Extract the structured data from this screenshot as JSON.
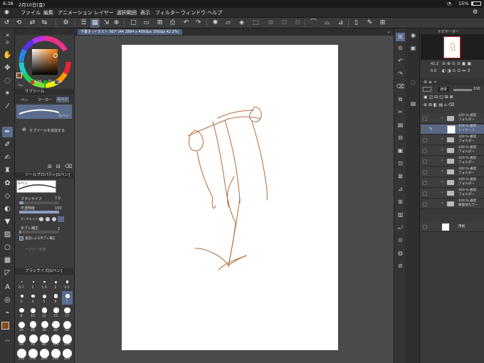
{
  "status": {
    "time": "6:38",
    "date": "2月10日(金)",
    "battery": "15%"
  },
  "menu": [
    "ファイル",
    "編集",
    "アニメーション",
    "レイヤー",
    "選択範囲",
    "表示",
    "フィルター",
    "ウィンドウ",
    "ヘルプ"
  ],
  "document": {
    "tab_title": "下書き (イラスト 30)* (A4 2894 x 4093px 350dpi 42.2%)"
  },
  "color": {
    "values": [
      "146",
      "70",
      "0"
    ],
    "main": "#8a4a16"
  },
  "subtool": {
    "header": "サブツール",
    "tabs": [
      "ペン",
      "マーカー",
      "Gペン"
    ],
    "brush_name": "Gペン",
    "add_label": "サブツールを追加する"
  },
  "tool_property": {
    "header": "ツールプロパティ[Gペン]",
    "preview_name": "Gペン",
    "brush_size_label": "ブラシサイズ",
    "brush_size_value": "7.0",
    "opacity_label": "不透明度",
    "opacity_value": "100",
    "antialias_label": "アンチエイリアス",
    "stabilization_label": "手ブレ補正",
    "stabilization_value": "2",
    "speed_stab_label": "速度による手ブレ補正",
    "vector_label": "ベクター吸着"
  },
  "brush_size_panel": {
    "header": "ブラシサイズ[Gペン]",
    "sizes": [
      "0.7",
      "1",
      "1.5",
      "2",
      "2.5",
      "3",
      "4",
      "5",
      "6",
      "7",
      "8",
      "10",
      "12",
      "15",
      "17",
      "20",
      "25",
      "30",
      "40",
      "50",
      "60",
      "70",
      "80",
      "100",
      "120",
      "150",
      "170",
      "200",
      "250",
      "300"
    ]
  },
  "navigator": {
    "header": "ナビゲーター",
    "zoom": "42.2",
    "rotate": "0.0"
  },
  "layer_panel": {
    "blend": "通常",
    "opacity": "100"
  },
  "layers": [
    {
      "pct": "100 %",
      "mode": "通常",
      "name": "フォルダー",
      "type": "folder"
    },
    {
      "pct": "100 %",
      "mode": "通常",
      "name": "レイヤー 1",
      "type": "raster",
      "selected": true
    },
    {
      "pct": "100 %",
      "mode": "通常",
      "name": "フォルダー",
      "type": "folder"
    },
    {
      "pct": "100 %",
      "mode": "通常",
      "name": "フォルダー",
      "type": "folder"
    },
    {
      "pct": "100 %",
      "mode": "通常",
      "name": "フォルダー",
      "type": "folder"
    },
    {
      "pct": "100 %",
      "mode": "通常",
      "name": "フォルダー",
      "type": "folder"
    },
    {
      "pct": "100 %",
      "mode": "通常",
      "name": "フォルダー",
      "type": "folder"
    },
    {
      "pct": "100 %",
      "mode": "通常",
      "name": "フォルダー",
      "type": "folder"
    },
    {
      "pct": "100 %",
      "mode": "通常",
      "name": "線画他カラー",
      "type": "folder"
    },
    {
      "pct": "",
      "mode": "",
      "name": "用紙",
      "type": "paper"
    }
  ]
}
